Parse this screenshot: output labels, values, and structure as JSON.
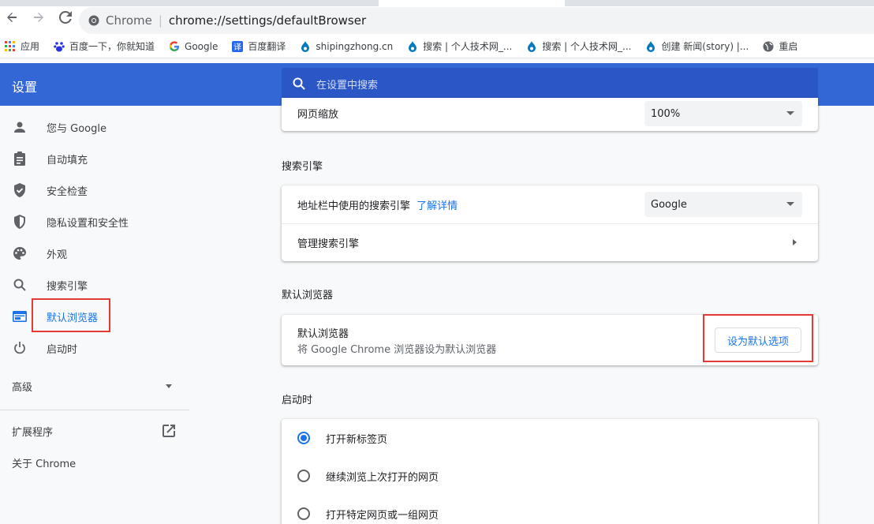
{
  "toolbar": {
    "site_name": "Chrome",
    "url": "chrome://settings/defaultBrowser"
  },
  "bookmarks": [
    {
      "label": "应用",
      "icon": "apps-grid-icon"
    },
    {
      "label": "百度一下，你就知道",
      "icon": "baidu-paw-icon"
    },
    {
      "label": "Google",
      "icon": "google-g-icon"
    },
    {
      "label": "百度翻译",
      "icon": "baidu-translate-icon"
    },
    {
      "label": "shipingzhong.cn",
      "icon": "drupal-drop-icon"
    },
    {
      "label": "搜索 | 个人技术网_...",
      "icon": "drupal-drop-icon"
    },
    {
      "label": "搜索 | 个人技术网_...",
      "icon": "drupal-drop-icon"
    },
    {
      "label": "创建 新闻(story) |...",
      "icon": "drupal-drop-icon"
    },
    {
      "label": "重启",
      "icon": "globe-icon"
    }
  ],
  "header": {
    "title": "设置",
    "search_placeholder": "在设置中搜索"
  },
  "sidebar": {
    "items": [
      {
        "label": "您与 Google",
        "icon": "person-icon"
      },
      {
        "label": "自动填充",
        "icon": "clipboard-icon"
      },
      {
        "label": "安全检查",
        "icon": "shield-check-icon"
      },
      {
        "label": "隐私设置和安全性",
        "icon": "shield-half-icon"
      },
      {
        "label": "外观",
        "icon": "palette-icon"
      },
      {
        "label": "搜索引擎",
        "icon": "search-icon"
      },
      {
        "label": "默认浏览器",
        "icon": "browser-window-icon"
      },
      {
        "label": "启动时",
        "icon": "power-icon"
      }
    ],
    "advanced": "高级",
    "extensions": "扩展程序",
    "about": "关于 Chrome"
  },
  "main": {
    "page_zoom": {
      "label": "网页缩放",
      "value": "100%"
    },
    "search_engine": {
      "section_title": "搜索引擎",
      "address_bar_label": "地址栏中使用的搜索引擎",
      "learn_more": "了解详情",
      "engine_value": "Google",
      "manage_label": "管理搜索引擎"
    },
    "default_browser": {
      "section_title": "默认浏览器",
      "title": "默认浏览器",
      "description": "将 Google Chrome 浏览器设为默认浏览器",
      "button": "设为默认选项"
    },
    "startup": {
      "section_title": "启动时",
      "options": [
        {
          "label": "打开新标签页",
          "checked": true
        },
        {
          "label": "继续浏览上次打开的网页",
          "checked": false
        },
        {
          "label": "打开特定网页或一组网页",
          "checked": false
        }
      ]
    }
  },
  "colors": {
    "accent": "#1a73e8",
    "header_blue": "#3367d6",
    "highlight_red": "#e53935"
  }
}
